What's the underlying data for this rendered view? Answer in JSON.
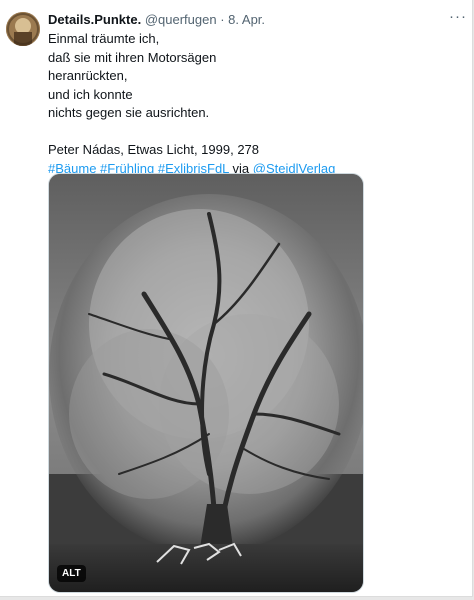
{
  "tweet": {
    "display_name": "Details.Punkte.",
    "handle": "@querfugen",
    "separator": "·",
    "date": "8. Apr.",
    "more_label": "···",
    "poem_lines": [
      "Einmal träumte ich,",
      "daß sie mit ihren Motorsägen",
      "heranrückten,",
      "und ich konnte",
      "nichts gegen sie ausrichten."
    ],
    "citation": "Peter Nádas, Etwas Licht, 1999, 278",
    "hashtags": [
      "#Bäume",
      "#Frühling",
      "#ExlibrisFdL"
    ],
    "via_word": "via",
    "mention": "@SteidlVerlag",
    "image_alt_badge": "ALT"
  },
  "colors": {
    "link": "#1d9bf0",
    "secondary_text": "#536471",
    "primary_text": "#0f1419",
    "background": "#ffffff"
  },
  "icons": {
    "more": "more-options-icon",
    "avatar": "profile-avatar"
  }
}
